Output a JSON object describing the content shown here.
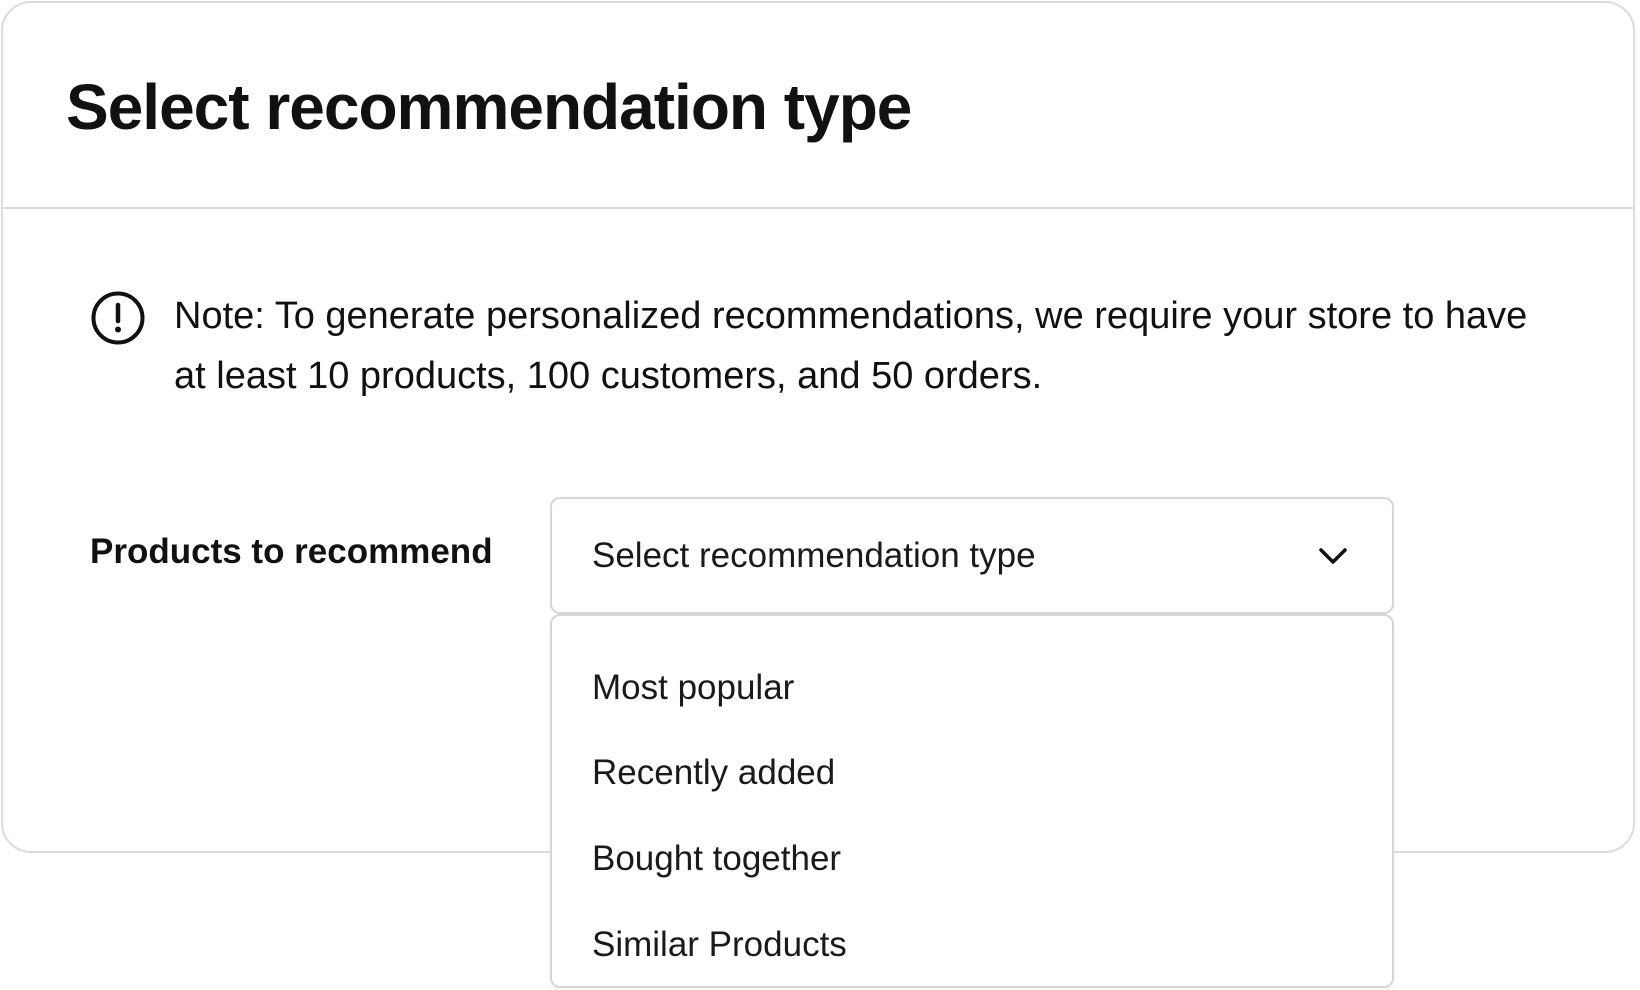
{
  "header": {
    "title": "Select recommendation type"
  },
  "note": {
    "icon": "alert-circle-icon",
    "text": "Note: To generate personalized recommendations, we require your store to have at least 10 products, 100 customers, and 50 orders."
  },
  "form": {
    "label": "Products to recommend",
    "select": {
      "value": "Select recommendation type",
      "icon": "chevron-down-icon",
      "expanded": true,
      "options": [
        "Most popular",
        "Recently added",
        "Bought together",
        "Similar Products"
      ]
    }
  },
  "colors": {
    "text": "#111111",
    "border": "#dcdcdc",
    "background": "#ffffff"
  }
}
